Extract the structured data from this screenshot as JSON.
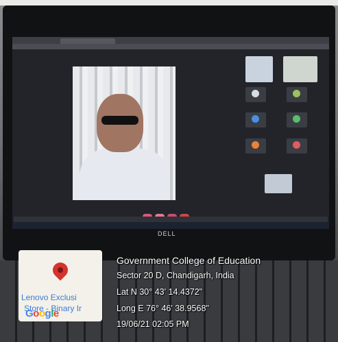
{
  "device": {
    "brand": "DELL"
  },
  "geotag": {
    "place_name": "Government College of Education",
    "address": "Sector 20 D, Chandigarh, India",
    "latitude": "Lat N 30° 43' 14.4372\"",
    "longitude": "Long E 76° 46' 38.9568\"",
    "datetime": "19/06/21 02:05 PM"
  },
  "map_thumbnail": {
    "store_line1": "Lenovo Exclusi",
    "store_line2": "Store - Binary Ir",
    "logo_letters": [
      "G",
      "o",
      "o",
      "g",
      "l",
      "e"
    ],
    "pin_color": "#d3342c"
  },
  "participant_tile_colors": [
    "#4a90e2",
    "#5bbd6b",
    "#e9823a",
    "#e05d5d",
    "#7f8fa6"
  ]
}
